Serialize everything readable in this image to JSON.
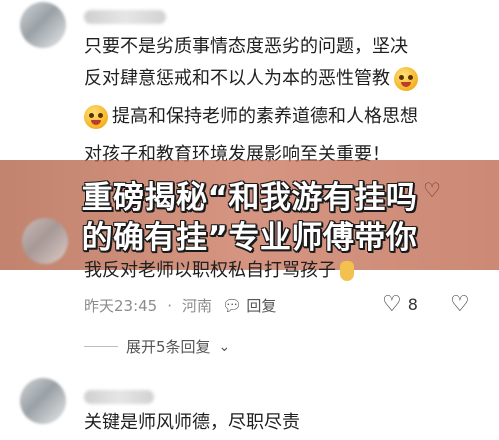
{
  "comment1": {
    "line1": "只要不是劣质事情态度恶劣的问题，坚决",
    "line2": "反对肆意惩戒和不以人为本的恶性管教",
    "line3": "提高和保持老师的素养道德和人格思想",
    "line4": "对孩子和教育环境发展影响至关重要！",
    "emoji": "grimace-emoji"
  },
  "banner": {
    "line1": "重磅揭秘“和我游有挂吗",
    "line2": "的确有挂”专业师傅带你"
  },
  "comment2": {
    "text": "我反对老师以职权私自打骂孩子",
    "time": "昨天23:45",
    "location": "河南",
    "reply_label": "回复",
    "like_count": "8",
    "icons": {
      "reply": "chat-bubble-icon",
      "like": "heart-icon",
      "dislike": "broken-heart-icon"
    }
  },
  "expand": {
    "label": "展开5条回复"
  },
  "comment3": {
    "text": "关键是师风师德，尽职尽责"
  }
}
